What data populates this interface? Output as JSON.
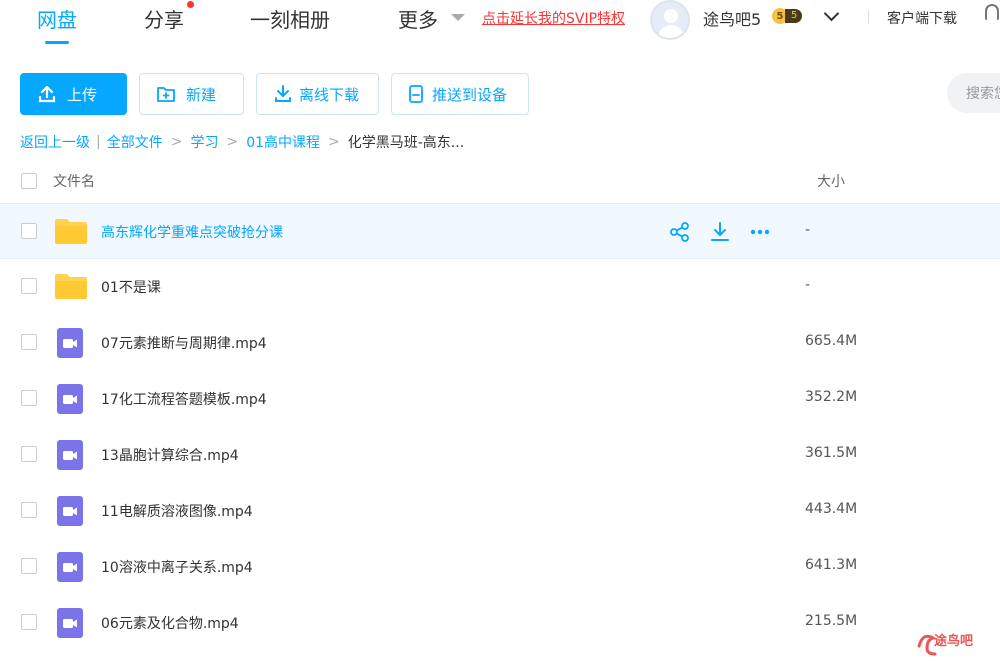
{
  "nav": {
    "tabs": [
      {
        "label": "网盘"
      },
      {
        "label": "分享"
      },
      {
        "label": "一刻相册"
      },
      {
        "label": "更多"
      }
    ],
    "svip_link": "点击延长我的SVIP特权",
    "username": "途鸟吧5",
    "level": "5",
    "level_tag": "5",
    "client_download": "客户端下载"
  },
  "toolbar": {
    "upload": "上传",
    "new": "新建",
    "offline_download": "离线下载",
    "push_to_device": "推送到设备",
    "search_placeholder": "搜索您"
  },
  "breadcrumb": {
    "back": "返回上一级",
    "items": [
      "全部文件",
      "学习",
      "01高中课程"
    ],
    "current": "化学黑马班-高东..."
  },
  "table": {
    "header_name": "文件名",
    "header_size": "大小",
    "rows": [
      {
        "type": "folder",
        "name": "高东辉化学重难点突破抢分课",
        "size": "-"
      },
      {
        "type": "folder",
        "name": "01不是课",
        "size": "-"
      },
      {
        "type": "video",
        "name": "07元素推断与周期律.mp4",
        "size": "665.4M"
      },
      {
        "type": "video",
        "name": "17化工流程答题模板.mp4",
        "size": "352.2M"
      },
      {
        "type": "video",
        "name": "13晶胞计算综合.mp4",
        "size": "361.5M"
      },
      {
        "type": "video",
        "name": "11电解质溶液图像.mp4",
        "size": "443.4M"
      },
      {
        "type": "video",
        "name": "10溶液中离子关系.mp4",
        "size": "641.3M"
      },
      {
        "type": "video",
        "name": "06元素及化合物.mp4",
        "size": "215.5M"
      }
    ]
  },
  "watermark": {
    "text": "途鸟吧"
  },
  "colors": {
    "accent": "#06a7ff",
    "video_icon": "#7b73e8",
    "folder_icon": "#ffd34f",
    "svip_red": "#ff3333"
  }
}
